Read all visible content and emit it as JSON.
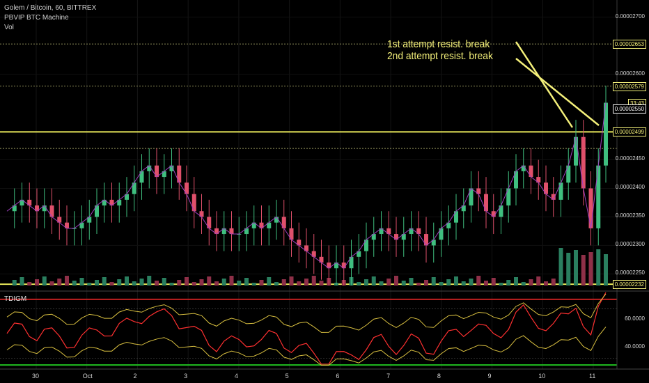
{
  "legend": {
    "line1": "Golem / Bitcoin, 60, BITTREX",
    "line2": "PBVIP BTC Machine",
    "line3": "Vol"
  },
  "annotations": {
    "first": "1st attempt resist. break",
    "second": "2nd attempt resist. break"
  },
  "chart_data": {
    "type": "line",
    "title": "Golem / Bitcoin, 60, BITTREX",
    "x_ticks": [
      "30",
      "Oct",
      "2",
      "3",
      "4",
      "5",
      "6",
      "7",
      "8",
      "9",
      "10",
      "11"
    ],
    "price_axis": {
      "ticks": [
        "0.00002700",
        "0.00002600",
        "0.00002450",
        "0.00002400",
        "0.00002350",
        "0.00002300",
        "0.00002250"
      ],
      "ylim": [
        2.22e-05,
        2.73e-05
      ]
    },
    "price_tags": [
      {
        "label": "0.00002653",
        "value": 2.653e-05,
        "color": "#f4f07a"
      },
      {
        "label": "0.00002579",
        "value": 2.579e-05,
        "color": "#f4f07a"
      },
      {
        "label": "33:43",
        "value": 2.55e-05,
        "color": "#f4f07a"
      },
      {
        "label": "0.00002550",
        "value": 2.54e-05,
        "color": "#ffffff"
      },
      {
        "label": "0.00002499",
        "value": 2.499e-05,
        "color": "#f4f07a"
      },
      {
        "label": "0.00002232",
        "value": 2.232e-05,
        "color": "#f4f07a"
      }
    ],
    "horizontal_levels": [
      2.653e-05,
      2.579e-05,
      2.499e-05,
      2.47e-05,
      2.232e-05
    ],
    "series": [
      {
        "values": [
          2.36e-05,
          2.37e-05,
          2.38e-05,
          2.37e-05,
          2.36e-05,
          2.37e-05,
          2.35e-05,
          2.34e-05,
          2.33e-05,
          2.33e-05,
          2.34e-05,
          2.35e-05,
          2.37e-05,
          2.38e-05,
          2.37e-05,
          2.38e-05,
          2.39e-05,
          2.41e-05,
          2.43e-05,
          2.44e-05,
          2.42e-05,
          2.43e-05,
          2.44e-05,
          2.41e-05,
          2.39e-05,
          2.36e-05,
          2.35e-05,
          2.33e-05,
          2.32e-05,
          2.33e-05,
          2.32e-05,
          2.32e-05,
          2.33e-05,
          2.34e-05,
          2.33e-05,
          2.34e-05,
          2.35e-05,
          2.33e-05,
          2.31e-05,
          2.3e-05,
          2.29e-05,
          2.28e-05,
          2.27e-05,
          2.26e-05,
          2.27e-05,
          2.26e-05,
          2.28e-05,
          2.29e-05,
          2.31e-05,
          2.32e-05,
          2.33e-05,
          2.32e-05,
          2.31e-05,
          2.32e-05,
          2.33e-05,
          2.32e-05,
          2.3e-05,
          2.31e-05,
          2.33e-05,
          2.34e-05,
          2.36e-05,
          2.37e-05,
          2.4e-05,
          2.39e-05,
          2.36e-05,
          2.35e-05,
          2.37e-05,
          2.4e-05,
          2.43e-05,
          2.44e-05,
          2.42e-05,
          2.41e-05,
          2.39e-05,
          2.38e-05,
          2.41e-05,
          2.44e-05,
          2.49e-05,
          2.4e-05,
          2.33e-05,
          2.44e-05,
          2.55e-05
        ]
      }
    ],
    "indicator": {
      "name": "TDIGM",
      "ticks": [
        "60.0000",
        "40.0000"
      ],
      "ylim": [
        25,
        80
      ],
      "levels": [
        68,
        32
      ]
    }
  }
}
